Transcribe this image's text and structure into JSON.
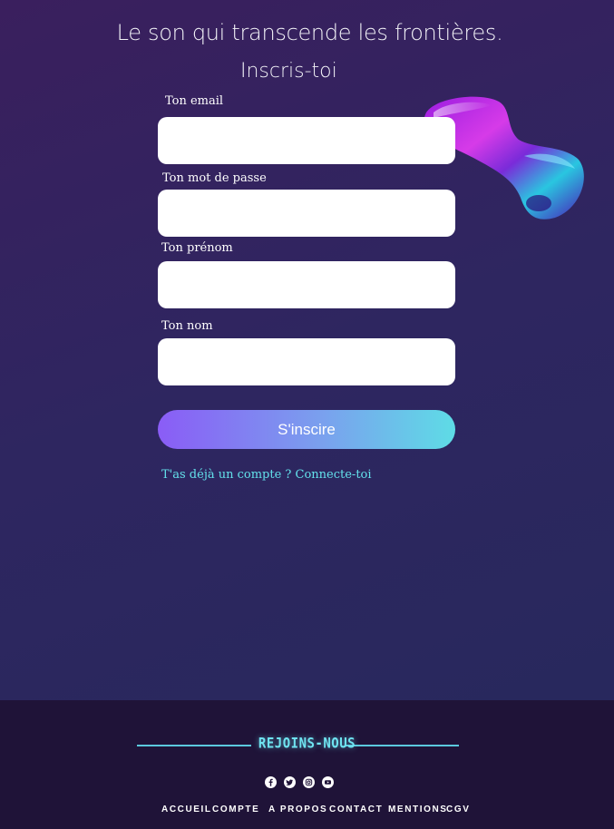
{
  "header": {
    "tagline": "Le son qui transcende les frontières.",
    "form_title": "Inscris-toi"
  },
  "form": {
    "email_label": "Ton email",
    "email_value": "",
    "password_label": "Ton mot de passe",
    "password_value": "",
    "firstname_label": "Ton prénom",
    "firstname_value": "",
    "lastname_label": "Ton nom",
    "lastname_value": "",
    "submit_label": "S'inscire",
    "login_link": "T'as déjà un compte ? Connecte-toi"
  },
  "footer": {
    "join_title": "REJOINS-NOUS",
    "socials": [
      "facebook-icon",
      "twitter-icon",
      "instagram-icon",
      "youtube-icon"
    ],
    "nav": [
      "ACCUEIL",
      "COMPTE",
      "A PROPOS",
      "CONTACT",
      "MENTIONS",
      "CGV"
    ]
  },
  "colors": {
    "accent_cyan": "#5edce6",
    "accent_purple": "#8a5cf6",
    "footer_bg": "#1f1338"
  }
}
